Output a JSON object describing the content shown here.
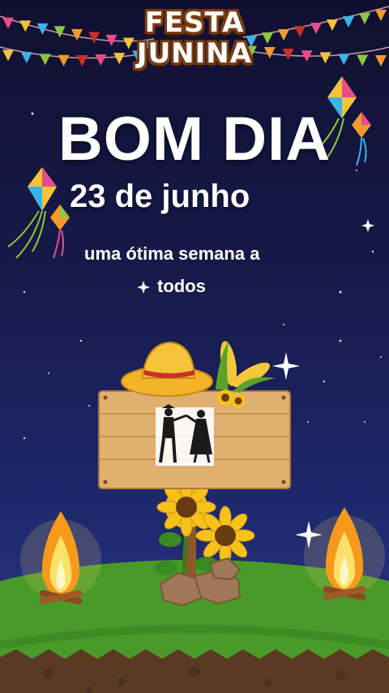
{
  "logo": {
    "line1": "FESTA",
    "line2": "JUNINA"
  },
  "greeting": "BOM DIA",
  "date": "23 de junho",
  "message_line1": "uma ótima semana a",
  "message_line2": "todos",
  "colors": {
    "sky_top": "#0f1030",
    "sky_bottom": "#2a3a8a",
    "grass": "#4a9a2a",
    "soil": "#5a3a22",
    "sign": "#e0b070"
  }
}
